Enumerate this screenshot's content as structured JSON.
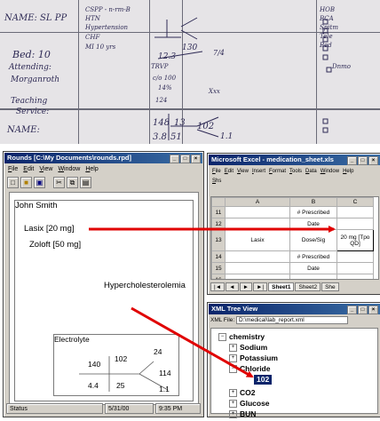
{
  "photo": {
    "labels": [
      "NAME: SL PP",
      "Bed: 10",
      "Attending:",
      "Morganroth",
      "Teaching",
      "Service:",
      "NAME:"
    ],
    "notes": [
      "CSPP - n-rm-B",
      "HTN",
      "Hypertension",
      "CHF",
      "MI 10 yrs",
      "TRVP",
      "c/o 100",
      "130",
      "12.3",
      "7/4",
      "14%",
      "Xxx",
      "124",
      "148",
      "13",
      "102",
      "3.8",
      "51",
      "1.1",
      "HOB",
      "BCA",
      "Spitm",
      "Tele",
      "Bed",
      "Dnmo"
    ]
  },
  "rounds": {
    "title": "Rounds [C:\\My Documents\\rounds.rpd]",
    "menu": [
      "File",
      "Edit",
      "View",
      "Window",
      "Help"
    ],
    "toolbar_icons": [
      "new-icon",
      "open-icon",
      "save-icon",
      "cut-icon",
      "copy-icon",
      "paste-icon"
    ],
    "patient_name": "John Smith",
    "medications": [
      "Lasix [20 mg]",
      "Zoloft [50 mg]"
    ],
    "diagnosis": "Hypercholesterolemia",
    "electrolyte": {
      "label": "Electrolyte",
      "values": [
        "140",
        "102",
        "24",
        "114",
        "4.4",
        "25",
        "1.1"
      ]
    },
    "status": {
      "left": "Status",
      "date": "5/31/00",
      "time": "9:35 PM"
    }
  },
  "excel": {
    "title": "Microsoft Excel - medication_sheet.xls",
    "menu": [
      "File",
      "Edit",
      "View",
      "Insert",
      "Format",
      "Tools",
      "Data",
      "Window",
      "Help"
    ],
    "menu2": "Shs",
    "columns": [
      "A",
      "B",
      "C"
    ],
    "rows": [
      {
        "num": "11",
        "b": "# Prescribed",
        "c": ""
      },
      {
        "num": "12",
        "b": "Date",
        "c": ""
      },
      {
        "num": "13",
        "a": "Lasix",
        "b": "Dose/Sig",
        "c": "20 mg [Tpo QD]"
      },
      {
        "num": "14",
        "b": "# Prescribed",
        "c": ""
      },
      {
        "num": "15",
        "b": "Date",
        "c": ""
      },
      {
        "num": "16",
        "b": "",
        "c": ""
      }
    ],
    "sheets": [
      "Sheet1",
      "Sheet2",
      "She"
    ]
  },
  "xml": {
    "title": "XML Tree View",
    "file_label": "XML File:",
    "file_value": "D:\\medical\\lab_report.xml",
    "tree": {
      "root": "chemistry",
      "children": [
        "Sodium",
        "Potassium",
        "Chloride",
        "CO2",
        "Glucose",
        "BUN"
      ],
      "selected_value": "102"
    }
  },
  "colors": {
    "arrow": "#e00000",
    "title_active": "#0a246a",
    "chrome": "#d4d0c8"
  }
}
